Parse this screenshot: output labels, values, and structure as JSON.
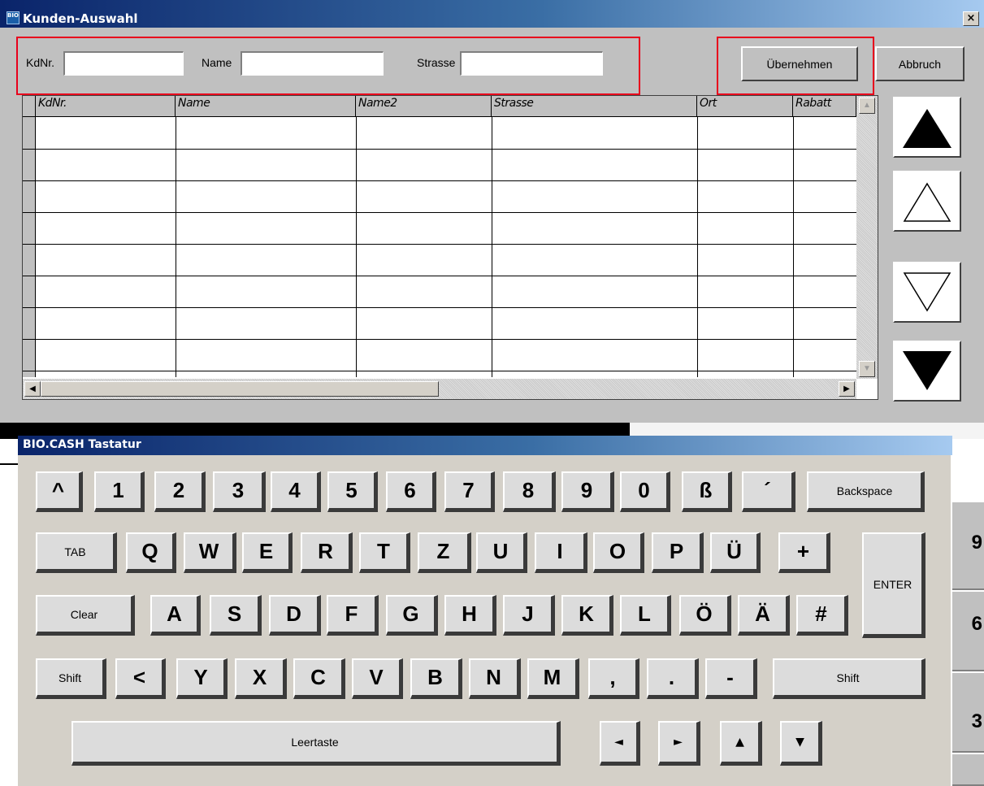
{
  "dialog": {
    "title": "Kunden-Auswahl",
    "icon_text": "BIO",
    "close_label": "×",
    "filters": {
      "kdnr_label": "KdNr.",
      "kdnr_value": "",
      "name_label": "Name",
      "name_value": "",
      "strasse_label": "Strasse",
      "strasse_value": ""
    },
    "buttons": {
      "ok": "Übernehmen",
      "cancel": "Abbruch"
    },
    "grid": {
      "columns": [
        "KdNr.",
        "Name",
        "Name2",
        "Strasse",
        "Ort",
        "Rabatt"
      ],
      "rows": []
    },
    "scroll": {
      "up": "▲",
      "down": "▼",
      "left": "◀",
      "right": "▶"
    },
    "nav_icons": [
      "first-page-icon",
      "previous-row-icon",
      "next-row-icon",
      "last-page-icon"
    ]
  },
  "background": {
    "side_digits": [
      "9",
      "6",
      "3"
    ]
  },
  "keyboard": {
    "title": "BIO.CASH Tastatur",
    "rows": [
      [
        "^",
        "1",
        "2",
        "3",
        "4",
        "5",
        "6",
        "7",
        "8",
        "9",
        "0",
        "ß",
        "´",
        "Backspace"
      ],
      [
        "TAB",
        "Q",
        "W",
        "E",
        "R",
        "T",
        "Z",
        "U",
        "I",
        "O",
        "P",
        "Ü",
        "+"
      ],
      [
        "Clear",
        "A",
        "S",
        "D",
        "F",
        "G",
        "H",
        "J",
        "K",
        "L",
        "Ö",
        "Ä",
        "#"
      ],
      [
        "Shift",
        "<",
        "Y",
        "X",
        "C",
        "V",
        "B",
        "N",
        "M",
        ",",
        ".",
        "-",
        "Shift"
      ]
    ],
    "enter": "ENTER",
    "space": "Leertaste",
    "arrows": [
      "◄",
      "►",
      "▲",
      "▼"
    ]
  },
  "colors": {
    "title_bar_start": "#0a246a",
    "title_bar_end": "#a6caf0",
    "highlight_box": "#e8001c",
    "dialog_bg": "#c0c0c0"
  }
}
